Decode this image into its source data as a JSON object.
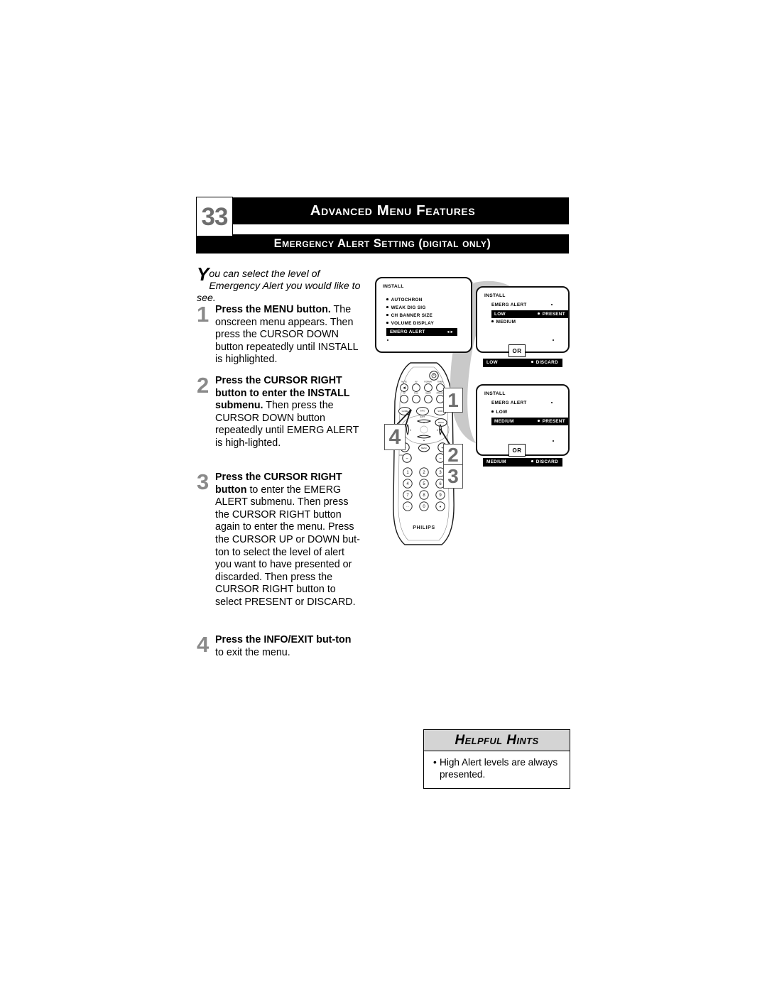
{
  "header": {
    "page_number": "33",
    "title": "Advanced Menu Features",
    "subtitle": "Emergency Alert Setting (digital only)"
  },
  "intro": {
    "dropcap": "Y",
    "text": "ou can select the level of Emergency Alert you would like to see."
  },
  "steps": [
    {
      "number": "1",
      "bold": "Press the MENU button.",
      "rest": " The onscreen menu appears. Then press the CURSOR DOWN button repeatedly until INSTALL is highlighted."
    },
    {
      "number": "2",
      "bold": "Press the CURSOR RIGHT button to enter the INSTALL submenu.",
      "rest": " Then press the CURSOR DOWN button repeatedly until EMERG ALERT is high-lighted."
    },
    {
      "number": "3",
      "bold": "Press the CURSOR RIGHT button",
      "rest": " to enter the EMERG ALERT submenu. Then press the CURSOR RIGHT button again to enter the menu.  Press the CURSOR UP or DOWN but-ton to select the level of alert you want to have presented or discarded.  Then press the CURSOR RIGHT button to select PRESENT or DISCARD."
    },
    {
      "number": "4",
      "bold": "Press the INFO/EXIT but-ton",
      "rest": " to exit the menu."
    }
  ],
  "callouts": {
    "one": "1",
    "two": "2",
    "three": "3",
    "four": "4"
  },
  "remote": {
    "brand": "PHILIPS",
    "power_icon": "power-icon",
    "row1": [
      "MUTE",
      "AV",
      "FORMAT",
      "TIMER"
    ],
    "row2": [
      "PIP",
      "POS",
      "SWAP",
      "PRESET"
    ],
    "row3": [
      "GUIDE",
      "INFO",
      "SURF"
    ],
    "info_sub": "EXIT",
    "menu_label": "MENU",
    "ok_label": "MENU",
    "volume_label": "VOLUME",
    "channel_label": "CH",
    "cursor_up": "∧",
    "cursor_down": "∨",
    "cursor_left": "〈",
    "cursor_right": "〉",
    "plus": "+",
    "minus": "−",
    "keypad": [
      "1",
      "2",
      "3",
      "4",
      "5",
      "6",
      "7",
      "8",
      "9",
      "0"
    ],
    "keypad_left": "••",
    "keypad_right": "●"
  },
  "tv_screens": {
    "panel_a": {
      "title": "INSTALL",
      "items": [
        "AUTOCHRON",
        "WEAK DIG SIG",
        "CH BANNER SIZE",
        "VOLUME DISPLAY"
      ],
      "highlight": "EMERG ALERT",
      "highlight_arrows": "◄►"
    },
    "panel_b": {
      "title": "INSTALL",
      "subtitle": "EMERG ALERT",
      "highlight_left": "LOW",
      "highlight_right": "PRESENT",
      "item": "MEDIUM",
      "or_label": "OR",
      "result_left": "LOW",
      "result_right": "DISCARD"
    },
    "panel_c": {
      "title": "INSTALL",
      "subtitle": "EMERG ALERT",
      "item": "LOW",
      "highlight_left": "MEDIUM",
      "highlight_right": "PRESENT",
      "or_label": "OR",
      "result_left": "MEDIUM",
      "result_right": "DISCARD"
    }
  },
  "hints": {
    "title": "Helpful Hints",
    "bullet": "•",
    "text": "High Alert levels are always presented."
  }
}
